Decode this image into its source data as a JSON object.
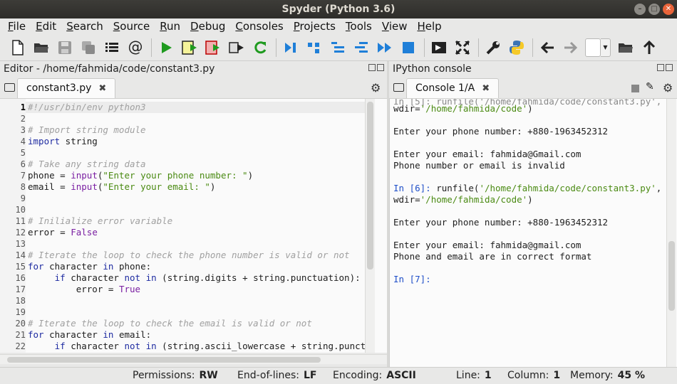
{
  "window": {
    "title": "Spyder (Python 3.6)"
  },
  "menu": [
    "File",
    "Edit",
    "Search",
    "Source",
    "Run",
    "Debug",
    "Consoles",
    "Projects",
    "Tools",
    "View",
    "Help"
  ],
  "editor": {
    "pane_title": "Editor - /home/fahmida/code/constant3.py",
    "tab_label": "constant3.py",
    "tab_close": "✖",
    "lines": [
      {
        "n": "1",
        "parts": [
          {
            "c": "shebang",
            "t": "#!/usr/bin/env python3"
          }
        ]
      },
      {
        "n": "2",
        "parts": []
      },
      {
        "n": "3",
        "parts": [
          {
            "c": "cm",
            "t": "# Import string module"
          }
        ]
      },
      {
        "n": "4",
        "parts": [
          {
            "c": "kw",
            "t": "import"
          },
          {
            "c": "tx",
            "t": " string"
          }
        ]
      },
      {
        "n": "5",
        "parts": []
      },
      {
        "n": "6",
        "parts": [
          {
            "c": "cm",
            "t": "# Take any string data"
          }
        ]
      },
      {
        "n": "7",
        "parts": [
          {
            "c": "tx",
            "t": "phone = "
          },
          {
            "c": "kb",
            "t": "input"
          },
          {
            "c": "tx",
            "t": "("
          },
          {
            "c": "st",
            "t": "\"Enter your phone number: \""
          },
          {
            "c": "tx",
            "t": ")"
          }
        ]
      },
      {
        "n": "8",
        "parts": [
          {
            "c": "tx",
            "t": "email = "
          },
          {
            "c": "kb",
            "t": "input"
          },
          {
            "c": "tx",
            "t": "("
          },
          {
            "c": "st",
            "t": "\"Enter your email: \""
          },
          {
            "c": "tx",
            "t": ")"
          }
        ]
      },
      {
        "n": "9",
        "parts": []
      },
      {
        "n": "10",
        "parts": []
      },
      {
        "n": "11",
        "parts": [
          {
            "c": "cm",
            "t": "# Inilialize error variable"
          }
        ]
      },
      {
        "n": "12",
        "parts": [
          {
            "c": "tx",
            "t": "error = "
          },
          {
            "c": "kb",
            "t": "False"
          }
        ]
      },
      {
        "n": "13",
        "parts": []
      },
      {
        "n": "14",
        "parts": [
          {
            "c": "cm",
            "t": "# Iterate the loop to check the phone number is valid or not"
          }
        ]
      },
      {
        "n": "15",
        "parts": [
          {
            "c": "kw",
            "t": "for"
          },
          {
            "c": "tx",
            "t": " character "
          },
          {
            "c": "kw",
            "t": "in"
          },
          {
            "c": "tx",
            "t": " phone:"
          }
        ]
      },
      {
        "n": "16",
        "parts": [
          {
            "c": "tx",
            "t": "     "
          },
          {
            "c": "kw",
            "t": "if"
          },
          {
            "c": "tx",
            "t": " character "
          },
          {
            "c": "kw",
            "t": "not in"
          },
          {
            "c": "tx",
            "t": " (string.digits + string.punctuation):"
          }
        ]
      },
      {
        "n": "17",
        "parts": [
          {
            "c": "tx",
            "t": "         error = "
          },
          {
            "c": "kb",
            "t": "True"
          }
        ]
      },
      {
        "n": "18",
        "parts": []
      },
      {
        "n": "19",
        "parts": []
      },
      {
        "n": "20",
        "parts": [
          {
            "c": "cm",
            "t": "# Iterate the loop to check the email is valid or not"
          }
        ]
      },
      {
        "n": "21",
        "parts": [
          {
            "c": "kw",
            "t": "for"
          },
          {
            "c": "tx",
            "t": " character "
          },
          {
            "c": "kw",
            "t": "in"
          },
          {
            "c": "tx",
            "t": " email:"
          }
        ]
      },
      {
        "n": "22",
        "parts": [
          {
            "c": "tx",
            "t": "     "
          },
          {
            "c": "kw",
            "t": "if"
          },
          {
            "c": "tx",
            "t": " character "
          },
          {
            "c": "kw",
            "t": "not in"
          },
          {
            "c": "tx",
            "t": " (string.ascii_lowercase + string.punct"
          }
        ]
      }
    ]
  },
  "console": {
    "pane_title": "IPython console",
    "tab_label": "Console 1/A",
    "tab_close": "✖",
    "lines": [
      {
        "parts": [
          {
            "c": "tx",
            "t": "wdir="
          },
          {
            "c": "path",
            "t": "'/home/fahmida/code'"
          },
          {
            "c": "tx",
            "t": ")"
          }
        ]
      },
      {
        "parts": []
      },
      {
        "parts": [
          {
            "c": "tx",
            "t": "Enter your phone number: +880-1963452312"
          }
        ]
      },
      {
        "parts": []
      },
      {
        "parts": [
          {
            "c": "tx",
            "t": "Enter your email: fahmida@Gmail.com"
          }
        ]
      },
      {
        "parts": [
          {
            "c": "tx",
            "t": "Phone number or email is invalid"
          }
        ]
      },
      {
        "parts": []
      },
      {
        "parts": [
          {
            "c": "prompt",
            "t": "In [6]: "
          },
          {
            "c": "tx",
            "t": "runfile("
          },
          {
            "c": "path",
            "t": "'/home/fahmida/code/constant3.py'"
          },
          {
            "c": "tx",
            "t": ","
          }
        ]
      },
      {
        "parts": [
          {
            "c": "tx",
            "t": "wdir="
          },
          {
            "c": "path",
            "t": "'/home/fahmida/code'"
          },
          {
            "c": "tx",
            "t": ")"
          }
        ]
      },
      {
        "parts": []
      },
      {
        "parts": [
          {
            "c": "tx",
            "t": "Enter your phone number: +880-1963452312"
          }
        ]
      },
      {
        "parts": []
      },
      {
        "parts": [
          {
            "c": "tx",
            "t": "Enter your email: fahmida@gmail.com"
          }
        ]
      },
      {
        "parts": [
          {
            "c": "tx",
            "t": "Phone and email are in correct format"
          }
        ]
      },
      {
        "parts": []
      },
      {
        "parts": [
          {
            "c": "prompt",
            "t": "In [7]:"
          }
        ]
      }
    ]
  },
  "status": {
    "permissions_label": "Permissions:",
    "permissions_value": "RW",
    "eol_label": "End-of-lines:",
    "eol_value": "LF",
    "encoding_label": "Encoding:",
    "encoding_value": "ASCII",
    "line_label": "Line:",
    "line_value": "1",
    "column_label": "Column:",
    "column_value": "1",
    "memory_label": "Memory:",
    "memory_value": "45 %"
  },
  "colors": {
    "keyword": "#1e2ba1",
    "builtin": "#7a1fa2",
    "string": "#4a8a12",
    "comment": "#a0a0a0",
    "run": "#1f9a1f",
    "debug": "#1f7fd8"
  }
}
